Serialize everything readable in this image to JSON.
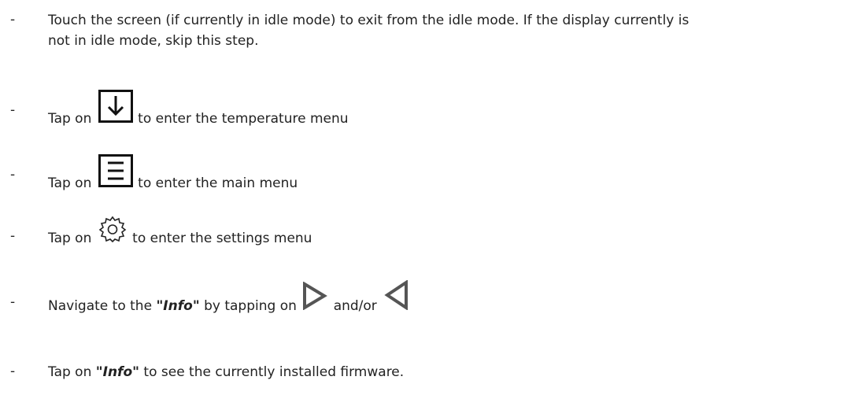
{
  "steps": [
    {
      "dash": "-",
      "line1": "Touch the screen (if currently in idle mode) to exit from the idle mode. If the display currently is",
      "line2": "not in idle mode, skip this step."
    },
    {
      "dash": "-",
      "prefix": "Tap on",
      "icon": "arrow-down-box-icon",
      "suffix": "to enter the temperature menu"
    },
    {
      "dash": "-",
      "prefix": "Tap on",
      "icon": "menu-box-icon",
      "suffix": "to enter the main menu"
    },
    {
      "dash": "-",
      "prefix": "Tap on",
      "icon": "gear-icon",
      "suffix": "to enter the settings menu"
    },
    {
      "dash": "-",
      "prefix": "Navigate to the",
      "quote_open": "\"",
      "emph": "Info",
      "quote_close": "\"",
      "middle": "by tapping on",
      "icon1": "play-right-icon",
      "conj": "and/or",
      "icon2": "play-left-icon"
    },
    {
      "dash": "-",
      "prefix": "Tap on",
      "quote_open": "\"",
      "emph": "Info",
      "quote_close": "\"",
      "suffix": "to see the currently installed firmware."
    }
  ]
}
